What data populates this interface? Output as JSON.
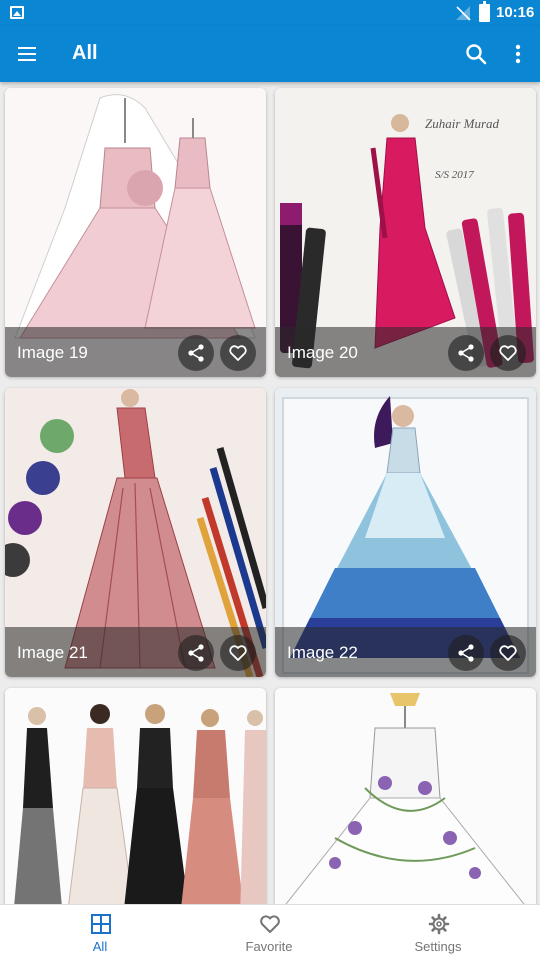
{
  "status_bar": {
    "time": "10:16"
  },
  "app_bar": {
    "title": "All"
  },
  "cards": [
    {
      "label": "Image 19"
    },
    {
      "label": "Image 20"
    },
    {
      "label": "Image 21"
    },
    {
      "label": "Image 22"
    },
    {
      "label": ""
    },
    {
      "label": ""
    }
  ],
  "bottom_nav": {
    "items": [
      {
        "label": "All",
        "icon": "grid-icon",
        "active": true
      },
      {
        "label": "Favorite",
        "icon": "heart-outline-icon",
        "active": false
      },
      {
        "label": "Settings",
        "icon": "gear-icon",
        "active": false
      }
    ]
  },
  "colors": {
    "primary": "#0a86d2",
    "accent": "#1a73c8",
    "inactive": "#757575"
  }
}
